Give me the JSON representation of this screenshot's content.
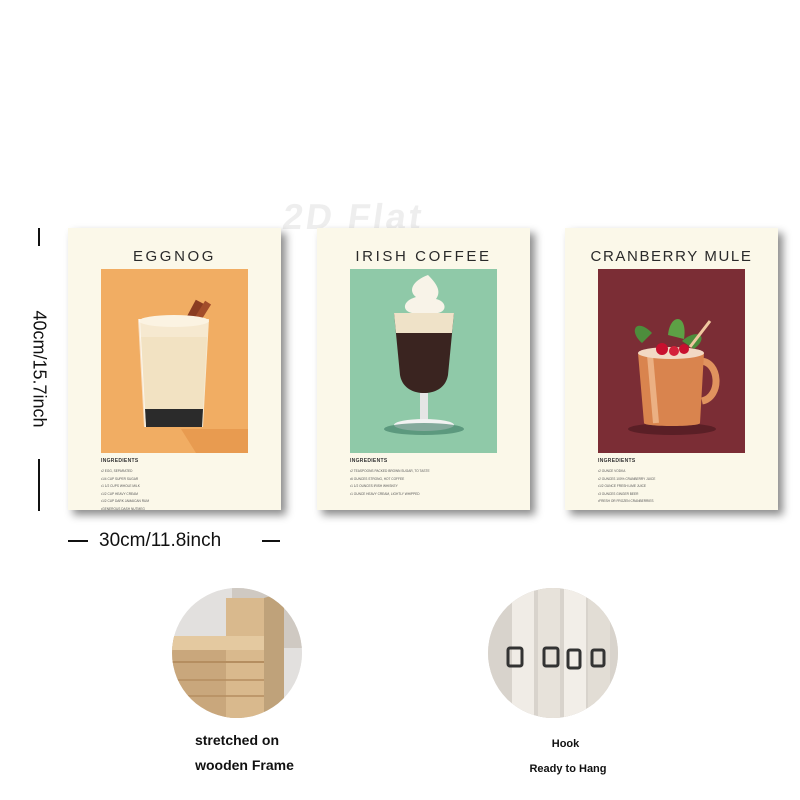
{
  "watermark": "2D Flat",
  "dimensions": {
    "height": "40cm/15.7inch",
    "width": "30cm/11.8inch"
  },
  "posters": [
    {
      "title": "EGGNOG",
      "ingredients_heading": "INGREDIENTS",
      "ingredients": [
        "2 EGG, SEPARATED",
        "1/4 CUP SUPER SUGAR",
        "1 1/2 CUPS WHOLE MILK",
        "1/2 CUP HEAVY CREAM",
        "1/2 CUP DARK JAMAICAN RUM",
        "GENEROUS DASH NUTMEG"
      ],
      "bg": "#f1ad63"
    },
    {
      "title": "IRISH COFFEE",
      "ingredients_heading": "INGREDIENTS",
      "ingredients": [
        "2 TEASPOONS PACKED BROWN SUGAR, TO TASTE",
        "6 OUNCES STRONG, HOT COFFEE",
        "1 1/2 OUNCES IRISH WHISKEY",
        "1 OUNCE HEAVY CREAM, LIGHTLY WHIPPED"
      ],
      "bg": "#8fc9a8"
    },
    {
      "title": "CRANBERRY MULE",
      "ingredients_heading": "INGREDIENTS",
      "ingredients": [
        "2 OUNCE VODKA",
        "2 OUNCES 100% CRANBERRY JUICE",
        "1/2 OUNCE FRESH LIME JUICE",
        "3 OUNCES GINGER BEER",
        "FRESH OR FROZEN CRANBERRIES"
      ],
      "bg": "#7b2d35"
    }
  ],
  "features": [
    {
      "line1": "stretched on",
      "line2": "wooden Frame"
    },
    {
      "line1": "Hook",
      "line2": "Ready to Hang"
    }
  ]
}
